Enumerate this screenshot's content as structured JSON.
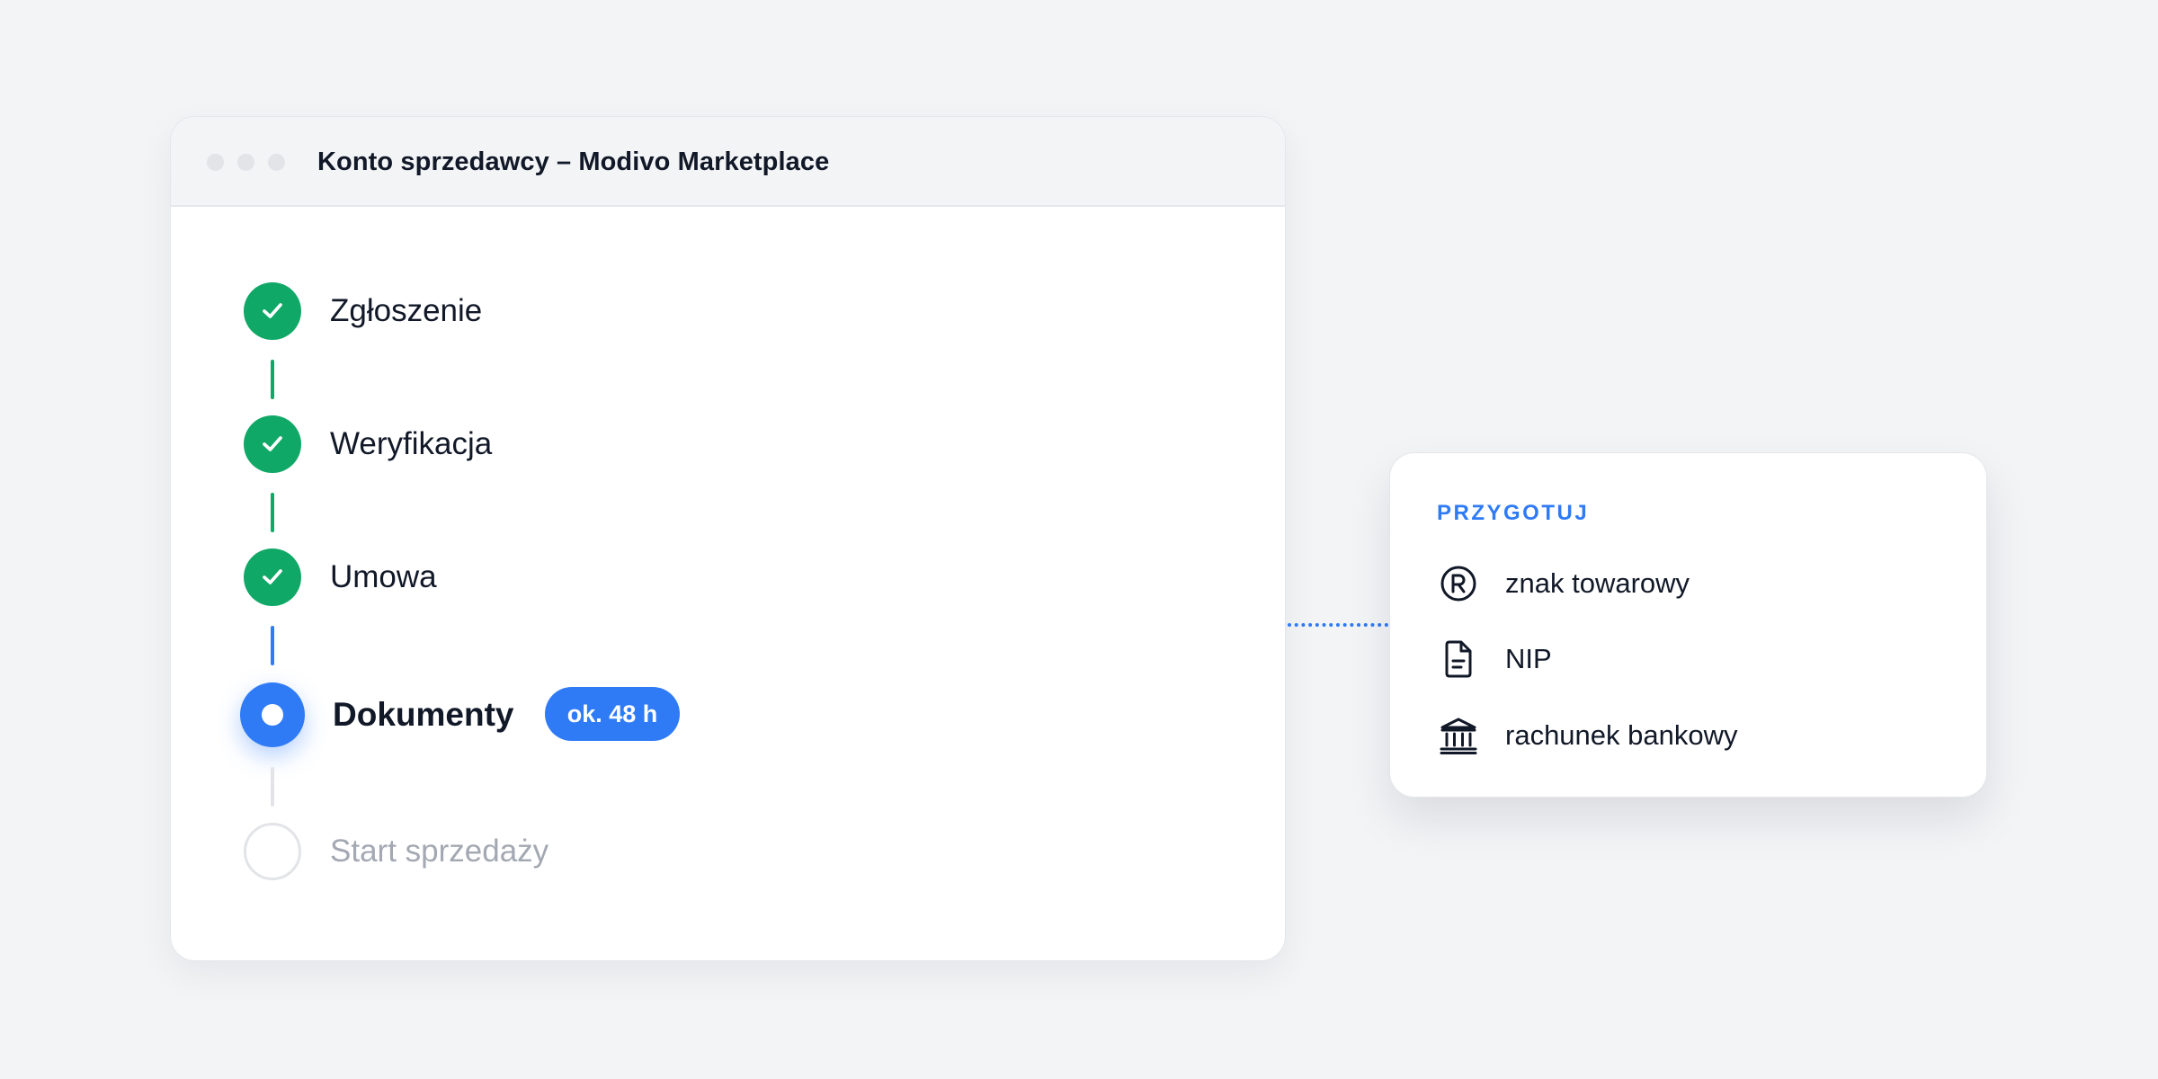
{
  "window": {
    "title": "Konto sprzedawcy – Modivo Marketplace"
  },
  "steps": [
    {
      "label": "Zgłoszenie",
      "status": "done"
    },
    {
      "label": "Weryfikacja",
      "status": "done"
    },
    {
      "label": "Umowa",
      "status": "done"
    },
    {
      "label": "Dokumenty",
      "status": "current",
      "badge": "ok. 48 h"
    },
    {
      "label": "Start sprzedaży",
      "status": "todo"
    }
  ],
  "prepare_card": {
    "title": "PRZYGOTUJ",
    "items": [
      {
        "label": "znak towarowy",
        "icon": "registered-trademark-icon"
      },
      {
        "label": "NIP",
        "icon": "document-icon"
      },
      {
        "label": "rachunek bankowy",
        "icon": "bank-icon"
      }
    ]
  },
  "colors": {
    "done": "#10a867",
    "current": "#2f7bf6",
    "todo": "#e2e4e8",
    "accent": "#2f7bf6"
  }
}
